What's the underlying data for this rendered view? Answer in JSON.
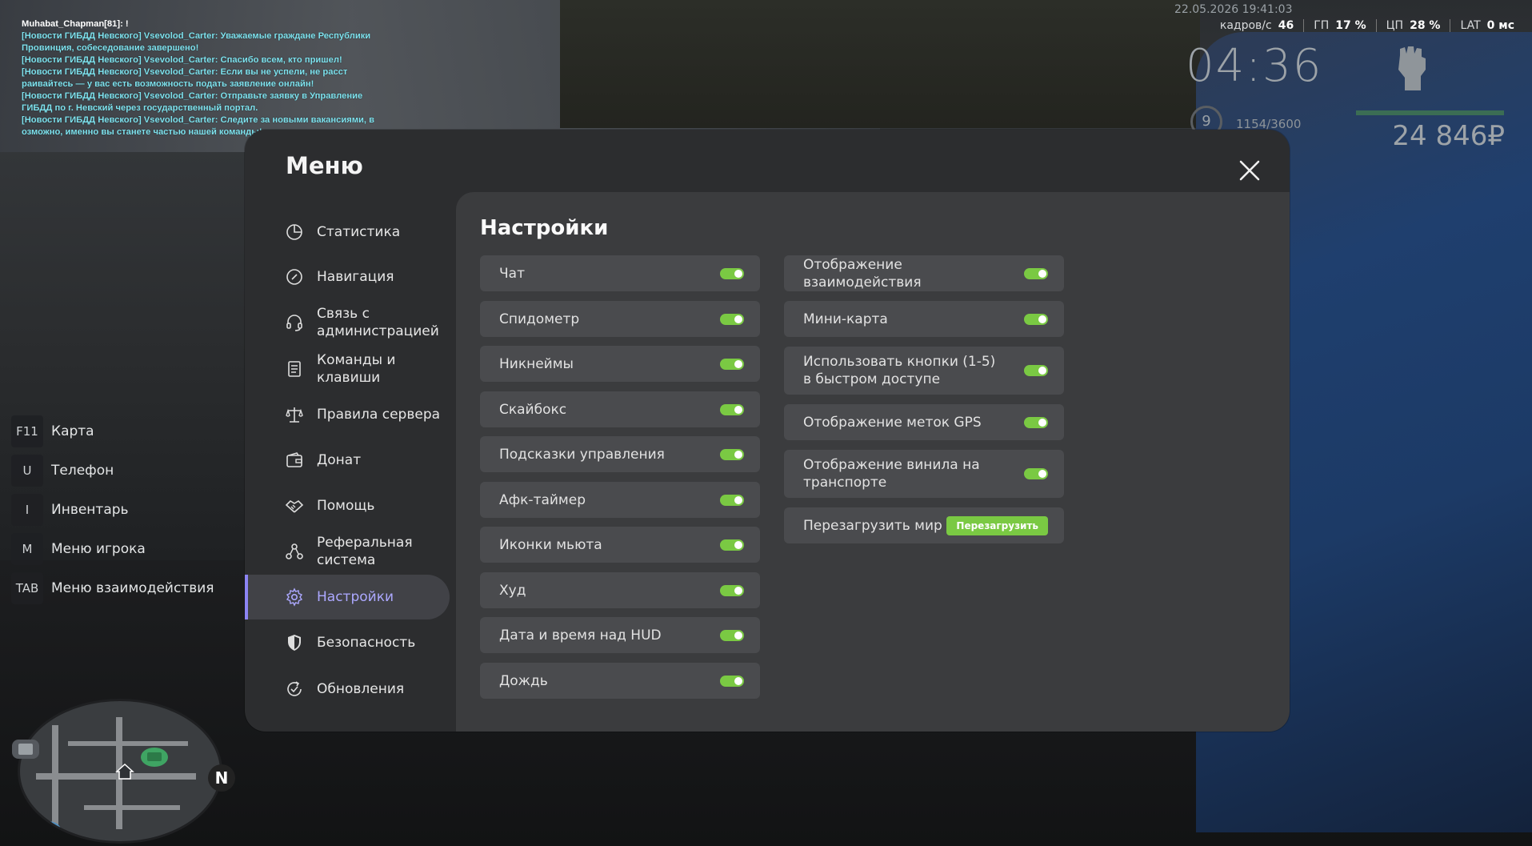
{
  "chat": {
    "nick_line": "Muhabat_Chapman[81]: !",
    "messages": [
      "[Новости ГИБДД Невского] Vsevolod_Carter: Уважаемые граждане Республики",
      " Провинция, собеседование завершено!",
      "[Новости ГИБДД Невского] Vsevolod_Carter: Спасибо всем, кто пришел!",
      "[Новости ГИБДД Невского] Vsevolod_Carter: Если вы не успели, не расст",
      "раивайтесь — у вас есть возможность подать заявление онлайн!",
      "[Новости ГИБДД Невского] Vsevolod_Carter: Отправьте заявку в Управление",
      " ГИБДД по г. Невский через государственный портал.",
      "[Новости ГИБДД Невского] Vsevolod_Carter: Следите за новыми вакансиями, в",
      "озможно, именно вы станете частью нашей команды!"
    ]
  },
  "hud": {
    "datetime": "22.05.2026 19:41:03",
    "fps_label": "кадров/с",
    "fps_value": "46",
    "gpu_label": "ГП",
    "gpu_value": "17 %",
    "cpu_label": "ЦП",
    "cpu_value": "28 %",
    "lat_label": "LAT",
    "lat_value": "0 мс",
    "time": "04:36",
    "level": "9",
    "exp": "1154/3600",
    "money": "24 846₽"
  },
  "keys": [
    {
      "key": "F11",
      "label": "Карта"
    },
    {
      "key": "U",
      "label": "Телефон"
    },
    {
      "key": "I",
      "label": "Инвентарь"
    },
    {
      "key": "M",
      "label": "Меню игрока"
    },
    {
      "key": "TAB",
      "label": "Меню взаимодействия"
    }
  ],
  "minimap": {
    "compass": "N"
  },
  "menu": {
    "title": "Меню",
    "nav": [
      {
        "label": "Статистика",
        "icon": "pie-chart-icon"
      },
      {
        "label": "Навигация",
        "icon": "compass-icon"
      },
      {
        "label": "Связь с администрацией",
        "icon": "headset-icon"
      },
      {
        "label": "Команды и клавиши",
        "icon": "document-list-icon"
      },
      {
        "label": "Правила сервера",
        "icon": "scales-icon"
      },
      {
        "label": "Донат",
        "icon": "wallet-icon"
      },
      {
        "label": "Помощь",
        "icon": "handshake-icon"
      },
      {
        "label": "Реферальная система",
        "icon": "referral-icon"
      },
      {
        "label": "Настройки",
        "icon": "gear-icon",
        "active": true
      },
      {
        "label": "Безопасность",
        "icon": "shield-icon"
      },
      {
        "label": "Обновления",
        "icon": "update-icon"
      }
    ],
    "settings": {
      "title": "Настройки",
      "left": [
        {
          "label": "Чат",
          "on": true
        },
        {
          "label": "Спидометр",
          "on": true
        },
        {
          "label": "Никнеймы",
          "on": true
        },
        {
          "label": "Скайбокс",
          "on": true
        },
        {
          "label": "Подсказки управления",
          "on": true
        },
        {
          "label": "Афк-таймер",
          "on": true
        },
        {
          "label": "Иконки мьюта",
          "on": true
        },
        {
          "label": "Худ",
          "on": true
        },
        {
          "label": "Дата и время над HUD",
          "on": true
        },
        {
          "label": "Дождь",
          "on": true
        }
      ],
      "right": [
        {
          "label": "Отображение взаимодействия",
          "on": true
        },
        {
          "label": "Мини-карта",
          "on": true
        },
        {
          "label": "Использовать кнопки (1-5) в быстром доступе",
          "on": true
        },
        {
          "label": "Отображение меток GPS",
          "on": true
        },
        {
          "label": "Отображение винила на транспорте",
          "on": true
        }
      ],
      "reload_label": "Перезагрузить мир",
      "reload_button": "Перезагрузить"
    }
  },
  "colors": {
    "accent": "#8c84f3",
    "toggle_on": "#7ac943",
    "chat_text": "#7fe3ef"
  }
}
